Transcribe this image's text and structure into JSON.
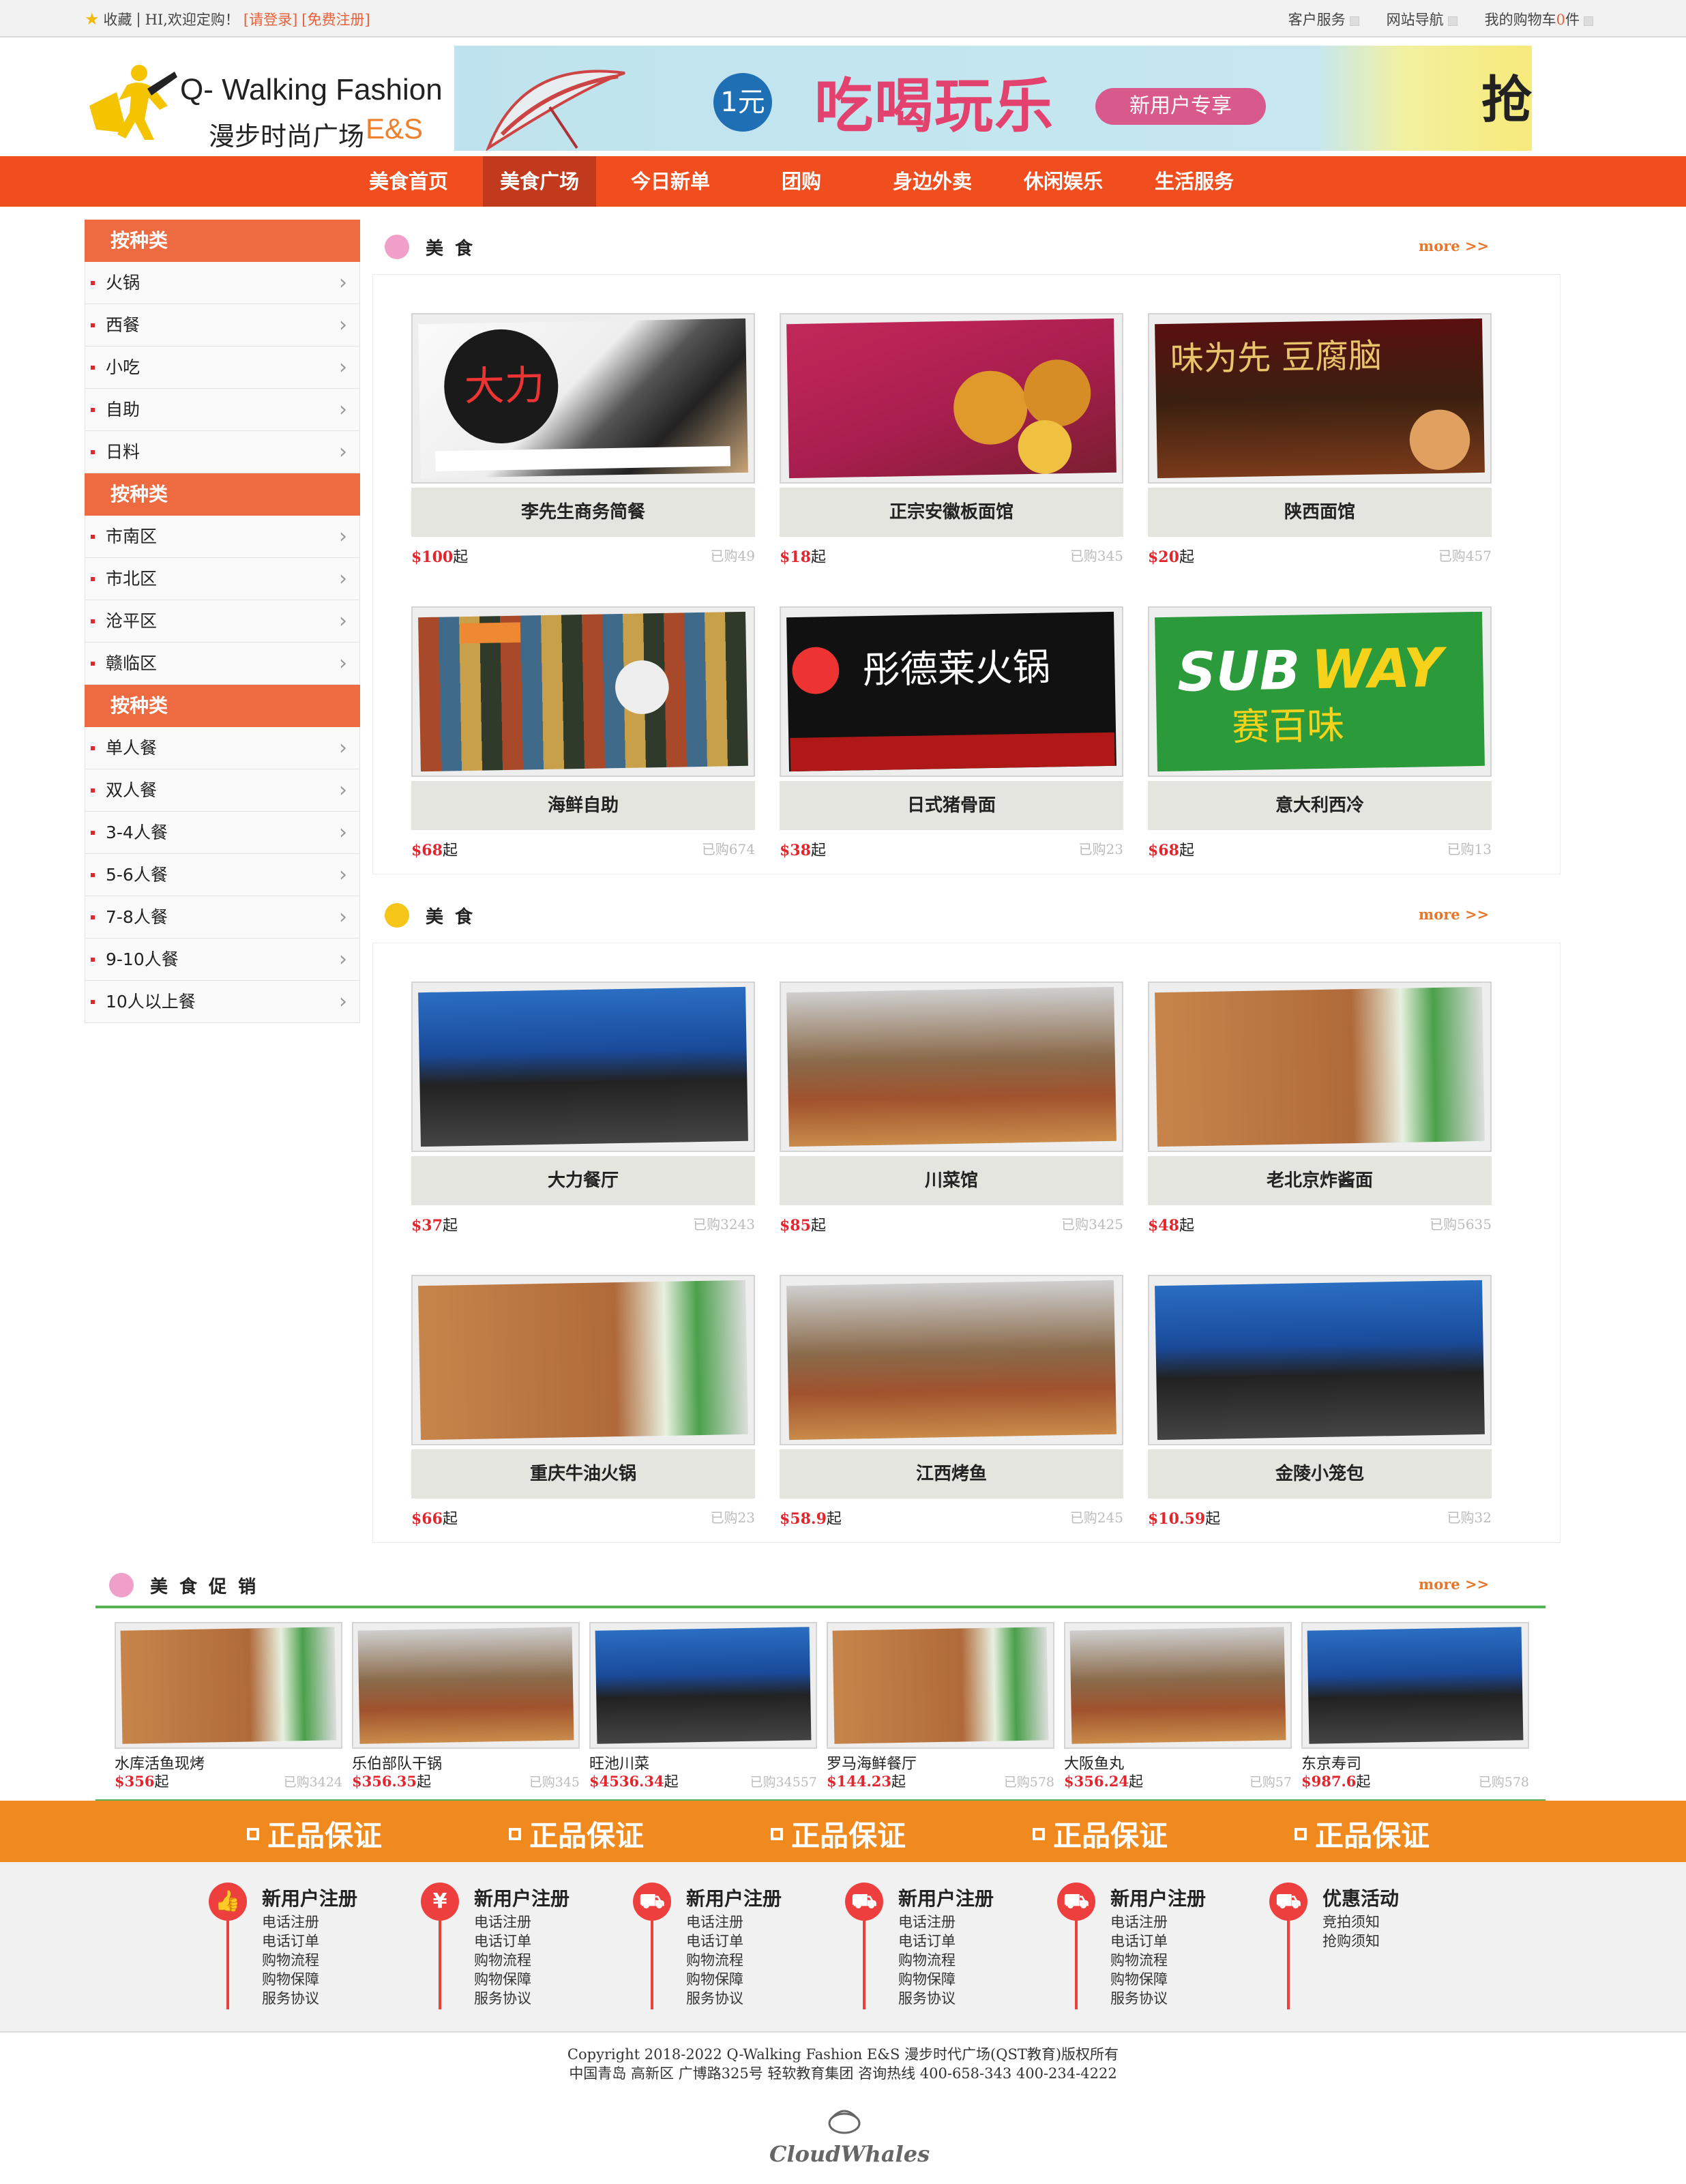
{
  "topbar": {
    "favorite": "收藏",
    "welcome": "HI,欢迎定购！",
    "login": "[请登录]",
    "register": "[免费注册]",
    "customer_service": "客户服务",
    "site_nav": "网站导航",
    "cart_prefix": "我的购物车",
    "cart_count": "0",
    "cart_suffix": "件"
  },
  "logo": {
    "line1": "Q- Walking Fashion",
    "line2": "漫步时尚广场",
    "brand": "E&S"
  },
  "banner": {
    "badge": "1元",
    "title": "吃喝玩乐",
    "tag": "新用户专享",
    "edge_char": "抢"
  },
  "nav": [
    "美食首页",
    "美食广场",
    "今日新单",
    "团购",
    "身边外卖",
    "休闲娱乐",
    "生活服务"
  ],
  "nav_active": 1,
  "sidebar": [
    {
      "title": "按种类",
      "items": [
        "火锅",
        "西餐",
        "小吃",
        "自助",
        "日料"
      ]
    },
    {
      "title": "按种类",
      "items": [
        "市南区",
        "市北区",
        "沧平区",
        "赣临区"
      ]
    },
    {
      "title": "按种类",
      "items": [
        "单人餐",
        "双人餐",
        "3-4人餐",
        "5-6人餐",
        "7-8人餐",
        "9-10人餐",
        "10人以上餐"
      ]
    }
  ],
  "sections": [
    {
      "title": "美 食",
      "more": "more >>",
      "items": [
        {
          "name": "李先生商务简餐",
          "price": "$100",
          "unit": "起",
          "sold": "已购49",
          "img_text": "大力"
        },
        {
          "name": "正宗安徽板面馆",
          "price": "$18",
          "unit": "起",
          "sold": "已购345",
          "img_text": ""
        },
        {
          "name": "陕西面馆",
          "price": "$20",
          "unit": "起",
          "sold": "已购457",
          "img_text": "味为先"
        },
        {
          "name": "海鲜自助",
          "price": "$68",
          "unit": "起",
          "sold": "已购674",
          "img_text": ""
        },
        {
          "name": "日式猪骨面",
          "price": "$38",
          "unit": "起",
          "sold": "已购23",
          "img_text": "彤德莱火锅"
        },
        {
          "name": "意大利西冷",
          "price": "$68",
          "unit": "起",
          "sold": "已购13",
          "img_text": "SUBWAY"
        }
      ]
    },
    {
      "title": "美 食",
      "more": "more >>",
      "items": [
        {
          "name": "大力餐厅",
          "price": "$37",
          "unit": "起",
          "sold": "已购3243"
        },
        {
          "name": "川菜馆",
          "price": "$85",
          "unit": "起",
          "sold": "已购3425"
        },
        {
          "name": "老北京炸酱面",
          "price": "$48",
          "unit": "起",
          "sold": "已购5635"
        },
        {
          "name": "重庆牛油火锅",
          "price": "$66",
          "unit": "起",
          "sold": "已购23"
        },
        {
          "name": "江西烤鱼",
          "price": "$58.9",
          "unit": "起",
          "sold": "已购245"
        },
        {
          "name": "金陵小笼包",
          "price": "$10.59",
          "unit": "起",
          "sold": "已购32"
        }
      ]
    }
  ],
  "promo": {
    "title": "美 食 促 销",
    "more": "more >>",
    "items": [
      {
        "name": "水库活鱼现烤",
        "price": "$356",
        "unit": "起",
        "sold": "已购3424"
      },
      {
        "name": "乐伯部队干锅",
        "price": "$356.35",
        "unit": "起",
        "sold": "已购345"
      },
      {
        "name": "旺池川菜",
        "price": "$4536.34",
        "unit": "起",
        "sold": "已购34557"
      },
      {
        "name": "罗马海鲜餐厅",
        "price": "$144.23",
        "unit": "起",
        "sold": "已购578"
      },
      {
        "name": "大阪鱼丸",
        "price": "$356.24",
        "unit": "起",
        "sold": "已购57"
      },
      {
        "name": "东京寿司",
        "price": "$987.6",
        "unit": "起",
        "sold": "已购578"
      }
    ]
  },
  "guarantee": [
    "正品保证",
    "正品保证",
    "正品保证",
    "正品保证",
    "正品保证"
  ],
  "help": [
    {
      "icon": "thumbs-up-icon",
      "glyph": "👍",
      "title": "新用户注册",
      "links": [
        "电话注册",
        "电话订单",
        "购物流程",
        "购物保障",
        "服务协议"
      ]
    },
    {
      "icon": "yen-icon",
      "glyph": "¥",
      "title": "新用户注册",
      "links": [
        "电话注册",
        "电话订单",
        "购物流程",
        "购物保障",
        "服务协议"
      ]
    },
    {
      "icon": "truck-icon",
      "glyph": "⛟",
      "title": "新用户注册",
      "links": [
        "电话注册",
        "电话订单",
        "购物流程",
        "购物保障",
        "服务协议"
      ]
    },
    {
      "icon": "truck-icon",
      "glyph": "⛟",
      "title": "新用户注册",
      "links": [
        "电话注册",
        "电话订单",
        "购物流程",
        "购物保障",
        "服务协议"
      ]
    },
    {
      "icon": "truck-icon",
      "glyph": "⛟",
      "title": "新用户注册",
      "links": [
        "电话注册",
        "电话订单",
        "购物流程",
        "购物保障",
        "服务协议"
      ]
    },
    {
      "icon": "truck-icon",
      "glyph": "⛟",
      "title": "优惠活动",
      "links": [
        "竞拍须知",
        "抢购须知"
      ]
    }
  ],
  "copyright": {
    "line1": "Copyright 2018-2022 Q-Walking Fashion E&S 漫步时代广场(QST教育)版权所有",
    "line2": "中国青岛 高新区 广博路325号 轻软教育集团 咨询热线 400-658-343 400-234-4222"
  },
  "watermark": "CloudWhales",
  "colors": {
    "nav": "#f04e1e",
    "nav_active": "#c23a1d",
    "sidebar_head": "#ee6b42",
    "price": "#e2262e",
    "more": "#e8762a",
    "guarantee": "#f08a1e",
    "promo_border": "#55b255",
    "help_icon": "#ee3f3f"
  }
}
